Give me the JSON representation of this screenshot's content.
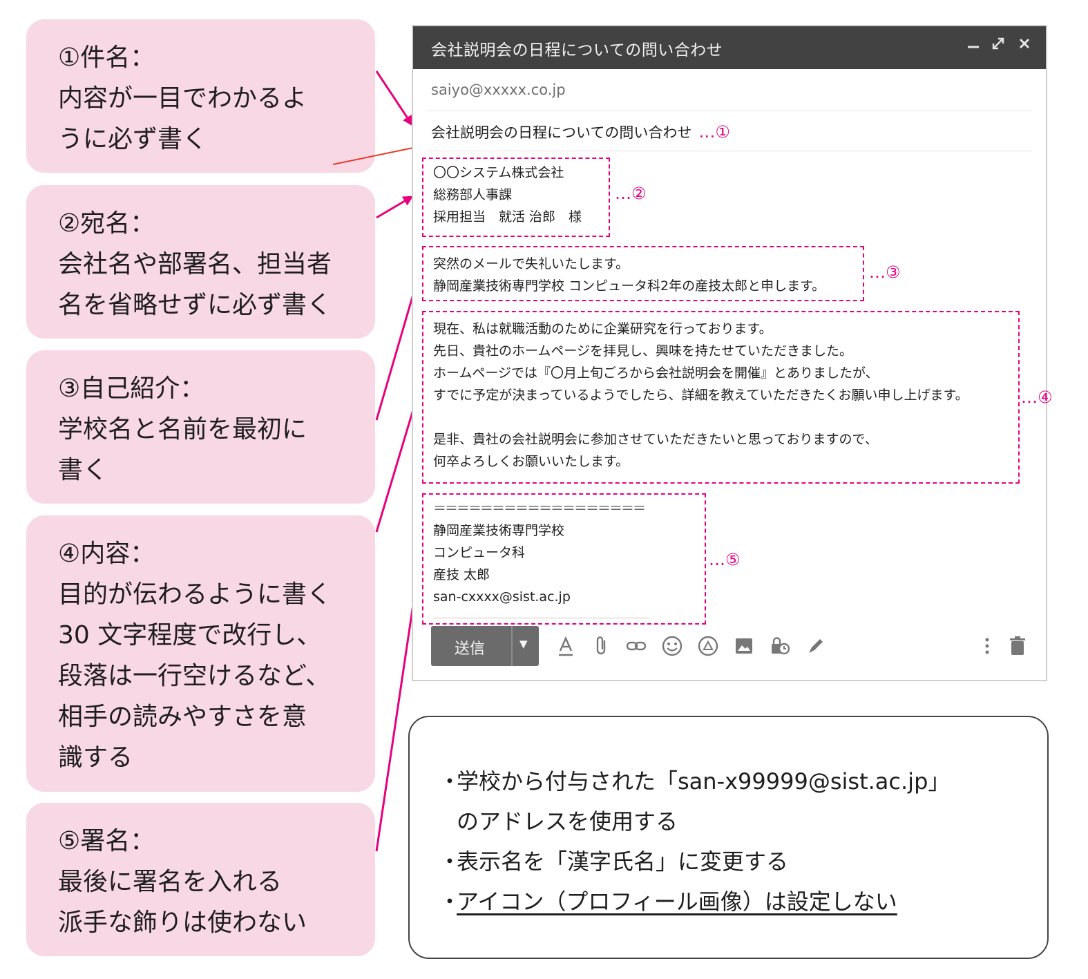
{
  "notes": [
    {
      "heading": "①件名：",
      "lines": [
        "内容が一目でわかるよ",
        "うに必ず書く"
      ]
    },
    {
      "heading": "②宛名：",
      "lines": [
        "会社名や部署名、担当者",
        "名を省略せずに必ず書く"
      ]
    },
    {
      "heading": "③自己紹介：",
      "lines": [
        "学校名と名前を最初に",
        "書く"
      ]
    },
    {
      "heading": "④内容：",
      "lines": [
        "目的が伝わるように書く",
        "30 文字程度で改行し、",
        "段落は一行空けるなど、",
        "相手の読みやすさを意",
        "識する"
      ]
    },
    {
      "heading": "⑤署名：",
      "lines": [
        "最後に署名を入れる",
        "派手な飾りは使わない"
      ]
    }
  ],
  "mail": {
    "window_title": "会社説明会の日程についての問い合わせ",
    "to": "saiyo@xxxxx.co.jp",
    "subject": "会社説明会の日程についての問い合わせ",
    "markers": [
      "…①",
      "…②",
      "…③",
      "…④",
      "…⑤"
    ],
    "addressee": [
      "〇〇システム株式会社",
      "総務部人事課",
      "採用担当　就活 治郎　様"
    ],
    "intro": [
      "突然のメールで失礼いたします。",
      "静岡産業技術専門学校 コンピュータ科2年の産技太郎と申します。"
    ],
    "body": [
      "現在、私は就職活動のために企業研究を行っております。",
      "先日、貴社のホームページを拝見し、興味を持たせていただきました。",
      "ホームページでは『〇月上旬ごろから会社説明会を開催』とありましたが、",
      "すでに予定が決まっているようでしたら、詳細を教えていただきたくお願い申し上げます。",
      "",
      "是非、貴社の会社説明会に参加させていただきたいと思っておりますので、",
      "何卒よろしくお願いいたします。"
    ],
    "signature": [
      "＝＝＝＝＝＝＝＝＝＝＝＝＝＝＝＝＝＝",
      "静岡産業技術専門学校",
      "コンピュータ科",
      "産技 太郎",
      "san-cxxxx@sist.ac.jp"
    ],
    "send_label": "送信",
    "toolbar_icons": [
      "format-text-icon",
      "attach-icon",
      "link-icon",
      "emoji-icon",
      "drive-icon",
      "photo-icon",
      "confidential-icon",
      "signature-pen-icon",
      "more-options-icon",
      "trash-icon"
    ]
  },
  "tips": {
    "bullet": "・",
    "lines": [
      "学校から付与された「san-x99999@sist.ac.jp」",
      "のアドレスを使用する",
      "表示名を「漢字氏名」に変更する",
      "アイコン（プロフィール画像）は設定しない"
    ]
  },
  "colors": {
    "pink_card": "#f9d8e5",
    "accent": "#e6007e",
    "titlebar": "#424242",
    "send_button": "#6b6b6b"
  }
}
